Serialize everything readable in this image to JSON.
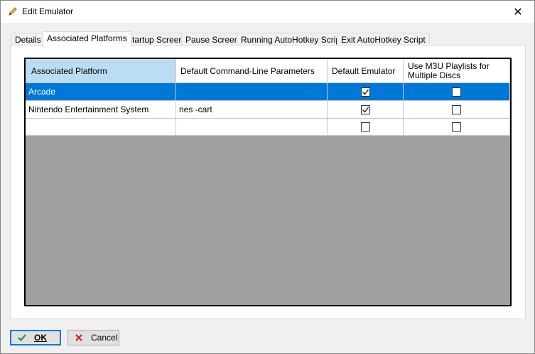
{
  "window": {
    "title": "Edit Emulator",
    "close_symbol": "✕"
  },
  "tabs": [
    {
      "label": "Details"
    },
    {
      "label": "Associated Platforms"
    },
    {
      "label": "Startup Screen"
    },
    {
      "label": "Pause Screen"
    },
    {
      "label": "Running AutoHotkey Script"
    },
    {
      "label": "Exit AutoHotkey Script"
    }
  ],
  "grid": {
    "headers": {
      "platform": "Associated Platform",
      "params": "Default Command-Line Parameters",
      "default": "Default Emulator",
      "m3u": "Use M3U Playlists for Multiple Discs"
    },
    "rows": [
      {
        "platform": "Arcade",
        "params": "",
        "default_emulator": true,
        "m3u": false,
        "selected": true
      },
      {
        "platform": "Nintendo Entertainment System",
        "params": "nes -cart",
        "default_emulator": true,
        "m3u": false,
        "selected": false
      },
      {
        "platform": "",
        "params": "",
        "default_emulator": false,
        "m3u": false,
        "selected": false
      }
    ]
  },
  "buttons": {
    "ok": "OK",
    "cancel": "Cancel"
  },
  "colors": {
    "selection": "#0078d7",
    "header_selected": "#bcdcf4",
    "grid_empty": "#a0a0a0",
    "ok_icon": "#2e9e3a",
    "cancel_icon": "#d42020"
  }
}
